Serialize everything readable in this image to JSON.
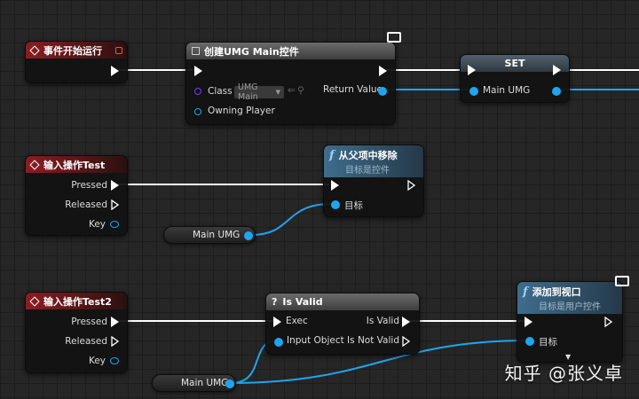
{
  "nodes": {
    "event_begin": {
      "title": "事件开始运行"
    },
    "create_umg": {
      "title": "创建UMG Main控件",
      "class_label": "Class",
      "class_value": "UMG Main",
      "owning_player": "Owning Player",
      "return_value": "Return Value"
    },
    "set": {
      "title": "SET",
      "var": "Main UMG"
    },
    "input_test": {
      "title": "输入操作Test",
      "pressed": "Pressed",
      "released": "Released",
      "key": "Key"
    },
    "remove_parent": {
      "title": "从父项中移除",
      "subtitle": "目标是控件",
      "target": "目标"
    },
    "var_get_1": {
      "label": "Main UMG"
    },
    "input_test2": {
      "title": "输入操作Test2",
      "pressed": "Pressed",
      "released": "Released",
      "key": "Key"
    },
    "is_valid": {
      "title": "Is Valid",
      "exec": "Exec",
      "input_object": "Input Object",
      "is_valid": "Is Valid",
      "is_not_valid": "Is Not Valid"
    },
    "add_viewport": {
      "title": "添加到视口",
      "subtitle": "目标是用户控件",
      "target": "目标"
    },
    "var_get_2": {
      "label": "Main UMG"
    }
  },
  "watermark": "知乎 @张义卓",
  "colors": {
    "exec": "#ffffff",
    "object_pin": "#1ea5f0",
    "class_pin": "#7c3cf0",
    "event_header": "#8c1d22"
  },
  "icons": [
    "diamond-event-icon",
    "function-icon",
    "question-icon",
    "screen-icon"
  ]
}
